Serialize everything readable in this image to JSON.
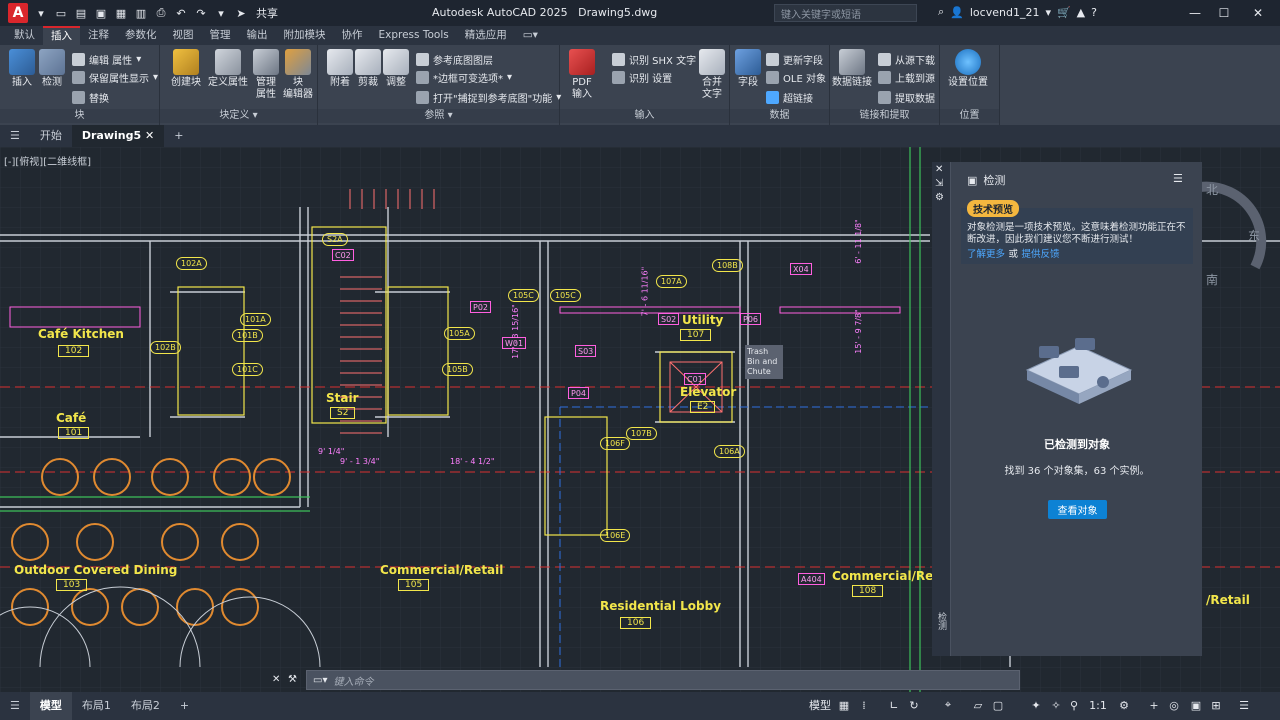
{
  "titlebar": {
    "share_label": "共享",
    "app_title": "Autodesk AutoCAD 2025",
    "file_name": "Drawing5.dwg",
    "search_placeholder": "键入关键字或短语",
    "user_name": "locvend1_21"
  },
  "ribbon_tabs": [
    "默认",
    "插入",
    "注释",
    "参数化",
    "视图",
    "管理",
    "输出",
    "附加模块",
    "协作",
    "Express Tools",
    "精选应用"
  ],
  "ribbon_active_tab": "插入",
  "ribbon": {
    "block": {
      "title": "块",
      "insert": "插入",
      "detect": "检测",
      "edit_attr": "编辑 属性",
      "keep_attr": "保留属性显示",
      "replace": "替换"
    },
    "block_def": {
      "title": "块定义",
      "create": "创建块",
      "define_attr": "定义属性",
      "manage_attr": "管理\n属性",
      "block_editor": "块\n编辑器"
    },
    "reference": {
      "title": "参照",
      "attach": "附着",
      "clip": "剪裁",
      "adjust": "调整",
      "underlay_layers": "参考底图图层",
      "frame_var": "*边框可变选项*",
      "snap_underlay": "打开\"捕捉到参考底图\"功能"
    },
    "import": {
      "title": "输入",
      "pdf_import": "PDF\n输入",
      "recognize_shx": "识别 SHX 文字",
      "recognize_settings": "识别 设置",
      "combine_text": "合并\n文字"
    },
    "data": {
      "title": "数据",
      "field": "字段",
      "update_fields": "更新字段",
      "ole_object": "OLE 对象",
      "hyperlink": "超链接"
    },
    "link_extract": {
      "title": "链接和提取",
      "data_link": "数据链接",
      "download_source": "从源下载",
      "upload_source": "上载到源",
      "extract_data": "提取数据"
    },
    "location": {
      "title": "位置",
      "set_location": "设置位置"
    }
  },
  "doc_tabs": {
    "start": "开始",
    "drawing": "Drawing5"
  },
  "canvas": {
    "view_label": "[-][俯视][二维线框]",
    "rooms": [
      {
        "name": "Café Kitchen",
        "num": "102"
      },
      {
        "name": "Café",
        "num": "101"
      },
      {
        "name": "Outdoor Covered Dining",
        "num": "103"
      },
      {
        "name": "Stair",
        "num": "S2"
      },
      {
        "name": "Utility",
        "num": "107"
      },
      {
        "name": "Elevator",
        "num": "E2"
      },
      {
        "name": "Commercial/Retail",
        "num": "105"
      },
      {
        "name": "Residential Lobby",
        "num": "106"
      },
      {
        "name": "Commercial/Retail",
        "num": "108"
      },
      {
        "name": "/Retail",
        "num": ""
      }
    ],
    "tags": [
      "S02",
      "P02",
      "W01",
      "P06",
      "S03",
      "P04",
      "C02",
      "C01",
      "X04",
      "A404"
    ],
    "ovals": [
      "102A",
      "102B",
      "101A",
      "101B",
      "101C",
      "105A",
      "105B",
      "105C",
      "105C",
      "107A",
      "108B",
      "107B",
      "106F",
      "106A",
      "106E",
      "S2A"
    ],
    "note": "Trash Bin and Chute",
    "dims": [
      "7' - 6 11/16\"",
      "17' - 3 15/16\"",
      "9' 1/4\"",
      "9' - 1 3/4\"",
      "18' - 4 1/2\"",
      "15' - 9 7/8\"",
      "6' - 11 1/8\""
    ],
    "compass": {
      "north": "北",
      "east": "东",
      "south": "南"
    }
  },
  "palette": {
    "title": "检测",
    "badge": "技术预览",
    "notice": "对象检测是一项技术预览。这意味着检测功能正在不断改进，因此我们建议您不断进行测试！",
    "learn_more": "了解更多",
    "or": "或",
    "feedback": "提供反馈",
    "detected_title": "已检测到对象",
    "detected_desc": "找到 36 个对象集，63 个实例。",
    "view_button": "查看对象",
    "side_label": "检测"
  },
  "cmdline": {
    "placeholder": "键入命令"
  },
  "statusbar": {
    "model": "模型",
    "layout1": "布局1",
    "layout2": "布局2",
    "model_space": "模型",
    "scale": "1:1"
  },
  "colors": {
    "accent": "#d9262c",
    "badge": "#f4b73f",
    "link": "#4ea8ff",
    "button": "#0d82d4",
    "room_label": "#f2e64b",
    "tag": "#ff5fe0"
  }
}
